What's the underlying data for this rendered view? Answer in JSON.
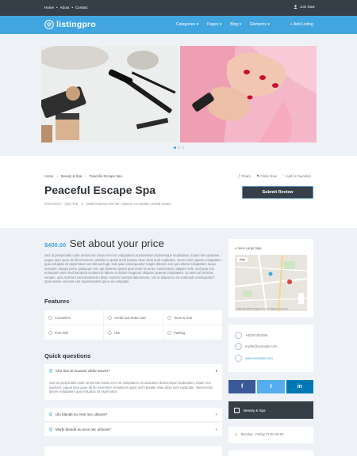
{
  "topbar": {
    "links": [
      "Home",
      "About",
      "Contact"
    ],
    "join": "Join Now"
  },
  "header": {
    "logo": "listingpro",
    "nav": [
      "Categories",
      "Pages",
      "Blog",
      "Elements"
    ],
    "add_listing": "Add Listing"
  },
  "breadcrumb": [
    "Home",
    "Beauty & Spa",
    "Peaceful Escape Spa"
  ],
  "actions": [
    "Share",
    "Claim Now",
    "Add to Favorites"
  ],
  "listing": {
    "title": "Peaceful Escape Spa",
    "date": "07/07/2017",
    "badge": "(Not Yet)",
    "address": "5056 Paterson Rd NE, Atlanta, GA 30308, United States",
    "submit_label": "Submit Review"
  },
  "pricing": {
    "price": "$400.00",
    "note": "Set about your price"
  },
  "description": "Sed ut perspiciatis unde omnis iste natus error sit voluptatem accusantium doloremque laudantium, totam rem aperiam, eaque ipsa quae ab illo inventore veritatis et quasi archi beatae vitae dicta sunt explicabo. Nemo enim ipsam voluptatem quia voluptas sit aspernatur aut odit aut fugit, sed quia consequuntur magni dolores eos qui ratione voluptatem sequi nesciunt. Neque porro quisquam est, qui dolorem ipsum quia dolor sit amet, consectetur, adipisci velit, sed quia non numquam eius modi tempora incidunt ut labore et dolore magnam aliquam quaerat voluptatem. Ut enim ad minima veniam, quis nostrum exercitationem ullam corporis suscipit laboriosam, nisi ut aliquid ex ea commodi consequatur? Quis autem vel eum iure reprehenderit qui in ea voluptate.",
  "features": {
    "title": "Features",
    "items": [
      "Cosmetics",
      "Credit and Debit card",
      "Tours & Tour",
      "Free Wifi",
      "Hair",
      "Parking"
    ]
  },
  "questions": {
    "title": "Quick questions",
    "items": [
      {
        "q": "Che fine di rivorarsi cifrite servici?",
        "open": true
      },
      {
        "q": "Ulo blandit eu eros nec ultrices?",
        "open": false
      },
      {
        "q": "Morbi blandit eu eros nec ultrices?",
        "open": false
      }
    ],
    "answer": "Sed ut perspiciatis unde omnis iste natus error sit voluptatem accusantium doloremque laudantium, totam rem aperiam, eaque ipsa quae ab illo inventore veritatis et quasi archi beatae vitae dicta sunt explicabo. Nemo enim ipsam voluptatem quia voluptas sit aspernatur."
  },
  "map": {
    "link": "View Large Map",
    "tab": "Map",
    "footer": "Map data ©2017 Google   Terms of Use   Report a map error"
  },
  "contact": {
    "phone": "+92367252459",
    "email": "myrtle@example.com",
    "website": "www.example.com"
  },
  "social": {
    "facebook": "f",
    "twitter": "t",
    "linkedin": "in"
  },
  "category": "Beauty & Spa",
  "hours": "Monday - Friday 07:00-20:00",
  "colors": {
    "accent": "#41a6e0",
    "dark": "#363f48",
    "facebook": "#3b5998",
    "twitter": "#55acee",
    "linkedin": "#0077b5"
  }
}
